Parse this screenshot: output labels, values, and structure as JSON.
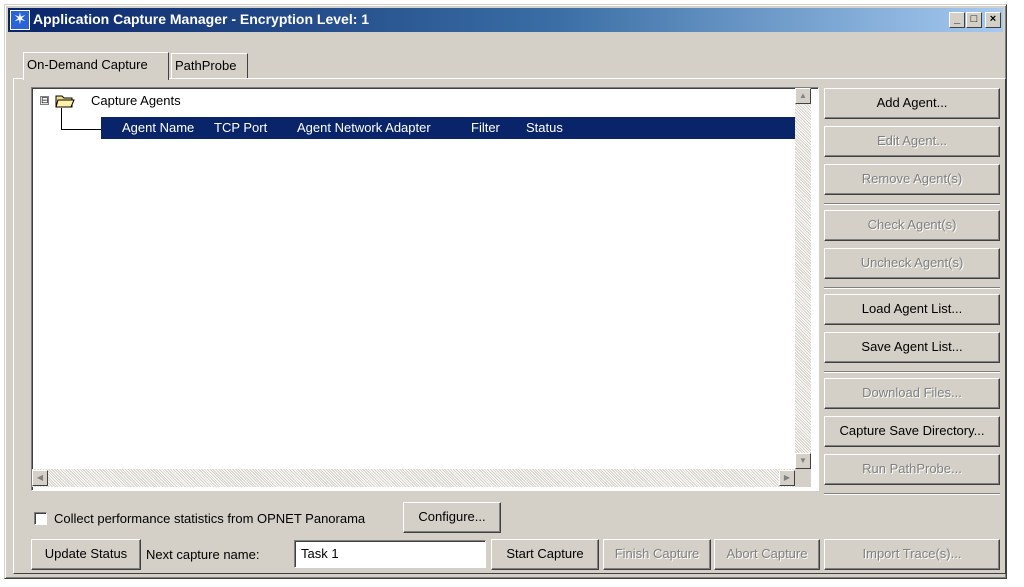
{
  "window": {
    "title": "Application Capture Manager - Encryption Level: 1",
    "controls": {
      "minimize": "_",
      "maximize": "□",
      "close": "×"
    }
  },
  "tabs": [
    {
      "label": "On-Demand Capture",
      "active": true
    },
    {
      "label": "PathProbe",
      "active": false
    }
  ],
  "tree": {
    "root_label": "Capture Agents",
    "expander": "⊟",
    "columns": [
      "Agent Name",
      "TCP Port",
      "Agent Network Adapter",
      "Filter",
      "Status"
    ]
  },
  "side_buttons": [
    {
      "label": "Add Agent...",
      "enabled": true
    },
    {
      "label": "Edit Agent...",
      "enabled": false
    },
    {
      "label": "Remove Agent(s)",
      "enabled": false
    },
    {
      "label": "Check Agent(s)",
      "enabled": false
    },
    {
      "label": "Uncheck Agent(s)",
      "enabled": false
    },
    {
      "label": "Load Agent List...",
      "enabled": true
    },
    {
      "label": "Save Agent List...",
      "enabled": true
    },
    {
      "label": "Download Files...",
      "enabled": false
    },
    {
      "label": "Capture Save Directory...",
      "enabled": true
    },
    {
      "label": "Run PathProbe...",
      "enabled": false
    }
  ],
  "performance": {
    "checkbox_label": "Collect performance statistics from OPNET Panorama",
    "checked": false,
    "configure_label": "Configure..."
  },
  "bottom": {
    "update_status_label": "Update Status",
    "next_capture_label": "Next capture name:",
    "next_capture_value": "Task 1",
    "start_capture_label": "Start Capture",
    "finish_capture_label": "Finish Capture",
    "abort_capture_label": "Abort Capture",
    "import_trace_label": "Import Trace(s)..."
  },
  "colors": {
    "title_gradient_start": "#0a246a",
    "title_gradient_end": "#a6caf0",
    "selection": "#0a246a",
    "face": "#d4d0c8"
  }
}
